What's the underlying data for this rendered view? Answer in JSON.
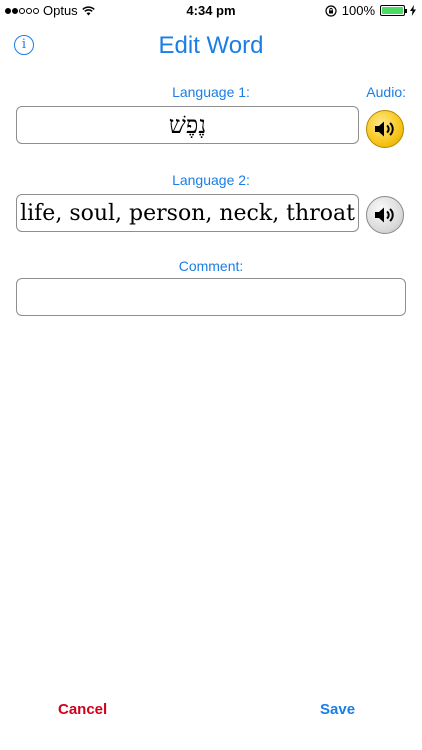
{
  "status_bar": {
    "carrier": "Optus",
    "time": "4:34 pm",
    "battery_percent": "100%",
    "signal_bars_filled": 2,
    "signal_bars_total": 5
  },
  "header": {
    "title": "Edit Word",
    "info_icon": "info-icon"
  },
  "form": {
    "language1_label": "Language 1:",
    "audio_label": "Audio:",
    "language1_value": "נֶפֶשׁ",
    "language2_label": "Language 2:",
    "language2_value": "life, soul, person, neck, throat",
    "comment_label": "Comment:",
    "comment_value": ""
  },
  "footer": {
    "cancel_label": "Cancel",
    "save_label": "Save"
  },
  "colors": {
    "accent": "#1a7ee6",
    "cancel": "#d0021b",
    "audio_active": "#f7c51a",
    "audio_inactive": "#d9d9d9"
  }
}
